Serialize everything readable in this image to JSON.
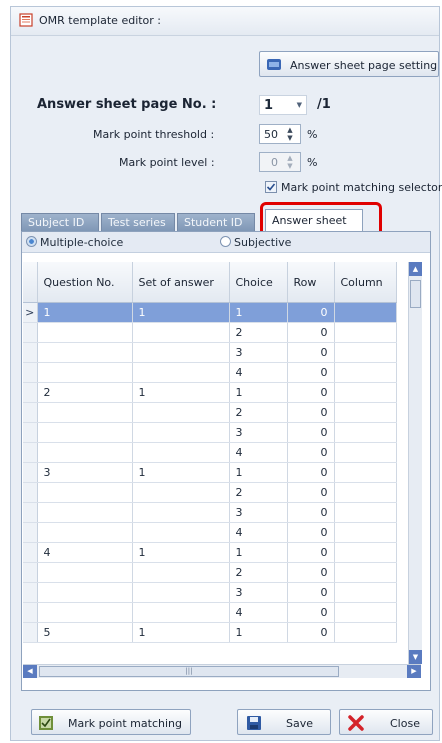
{
  "window": {
    "title": "OMR template editor :"
  },
  "toolbar": {
    "page_setting_label": "Answer sheet page setting"
  },
  "page": {
    "label": "Answer sheet page No. :",
    "value": "1",
    "total": "/1"
  },
  "threshold": {
    "label": "Mark point threshold :",
    "value": "50",
    "unit": "%"
  },
  "level": {
    "label": "Mark point level :",
    "value": "0",
    "unit": "%"
  },
  "matching_selector": {
    "label": "Mark point matching selector.",
    "checked": true
  },
  "tabs": [
    {
      "label": "Subject ID"
    },
    {
      "label": "Test series"
    },
    {
      "label": "Student ID"
    },
    {
      "label": "Answer sheet",
      "active": true
    }
  ],
  "mode": {
    "multiple_choice": "Multiple-choice",
    "subjective": "Subjective",
    "selected": "multiple_choice"
  },
  "grid": {
    "columns": [
      "Question No.",
      "Set of answer",
      "Choice",
      "Row",
      "Column"
    ],
    "rows": [
      [
        "1",
        "1",
        "1",
        "0",
        ""
      ],
      [
        "",
        "",
        "2",
        "0",
        ""
      ],
      [
        "",
        "",
        "3",
        "0",
        ""
      ],
      [
        "",
        "",
        "4",
        "0",
        ""
      ],
      [
        "2",
        "1",
        "1",
        "0",
        ""
      ],
      [
        "",
        "",
        "2",
        "0",
        ""
      ],
      [
        "",
        "",
        "3",
        "0",
        ""
      ],
      [
        "",
        "",
        "4",
        "0",
        ""
      ],
      [
        "3",
        "1",
        "1",
        "0",
        ""
      ],
      [
        "",
        "",
        "2",
        "0",
        ""
      ],
      [
        "",
        "",
        "3",
        "0",
        ""
      ],
      [
        "",
        "",
        "4",
        "0",
        ""
      ],
      [
        "4",
        "1",
        "1",
        "0",
        ""
      ],
      [
        "",
        "",
        "2",
        "0",
        ""
      ],
      [
        "",
        "",
        "3",
        "0",
        ""
      ],
      [
        "",
        "",
        "4",
        "0",
        ""
      ],
      [
        "5",
        "1",
        "1",
        "0",
        ""
      ]
    ],
    "selected_row": 0,
    "row_indicator": ">"
  },
  "buttons": {
    "matching": "Mark point matching",
    "save": "Save",
    "close": "Close"
  },
  "colors": {
    "selected_row": "#7f9fd9",
    "tab_inactive": "#8ea4c2",
    "highlight": "#e00000"
  }
}
